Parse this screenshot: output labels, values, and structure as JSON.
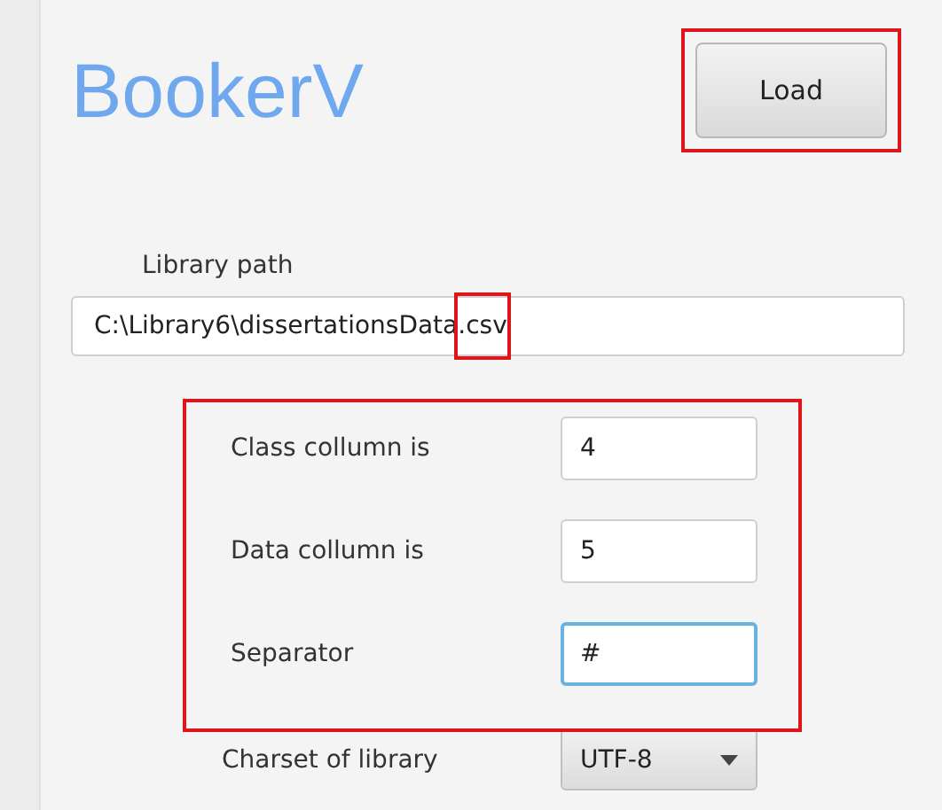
{
  "title": "BookerV",
  "load_button": {
    "label": "Load"
  },
  "library_path": {
    "label": "Library path",
    "value": "C:\\Library6\\dissertationsData.csv"
  },
  "settings": [
    {
      "label": "Class collumn is",
      "value": "4",
      "focused": false
    },
    {
      "label": "Data collumn is",
      "value": "5",
      "focused": false
    },
    {
      "label": "Separator",
      "value": "#",
      "focused": true
    }
  ],
  "charset": {
    "label": "Charset of library",
    "value": "UTF-8"
  },
  "highlight_frames": [
    {
      "kind": "button"
    },
    {
      "kind": "file-extension"
    },
    {
      "kind": "settings-group"
    }
  ]
}
